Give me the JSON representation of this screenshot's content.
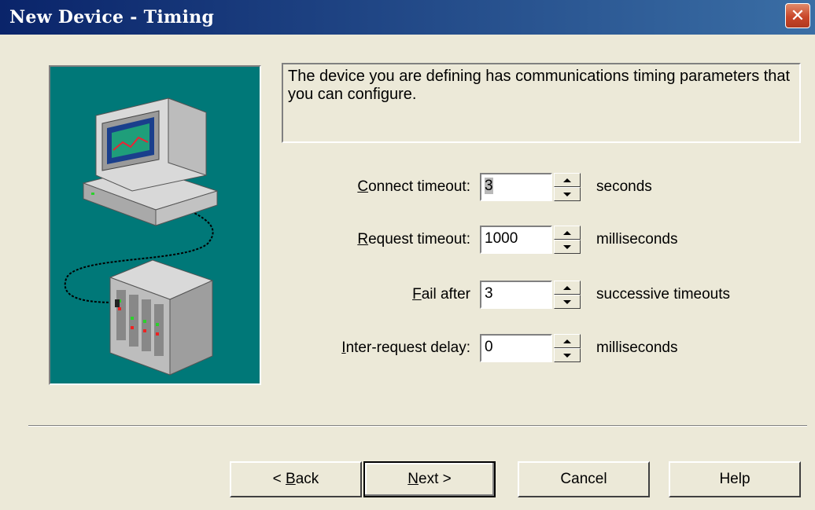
{
  "window": {
    "title": "New Device - Timing",
    "close_glyph": "✕"
  },
  "description": "The device you are defining has communications timing parameters that you can configure.",
  "fields": [
    {
      "label_first": "C",
      "label_rest": "onnect timeout:",
      "value": "3",
      "unit": "seconds"
    },
    {
      "label_first": "R",
      "label_rest": "equest timeout:",
      "value": "1000",
      "unit": "milliseconds"
    },
    {
      "label_first": "F",
      "label_rest": "ail after",
      "value": "3",
      "unit": "successive timeouts"
    },
    {
      "label_first": "I",
      "label_rest": "nter-request delay:",
      "value": "0",
      "unit": "milliseconds"
    }
  ],
  "buttons": {
    "back_prefix": "< ",
    "back_accel": "B",
    "back_rest": "ack",
    "next_accel": "N",
    "next_rest": "ext >",
    "cancel": "Cancel",
    "help": "Help"
  },
  "icons": [
    "computer-illustration",
    "device-rack-illustration",
    "close-icon",
    "spin-up-icon",
    "spin-down-icon"
  ],
  "colors": {
    "titlebar_start": "#0a246a",
    "titlebar_end": "#3a6ea5",
    "illustration_bg": "#007878",
    "dialog_bg": "#ece9d8"
  }
}
